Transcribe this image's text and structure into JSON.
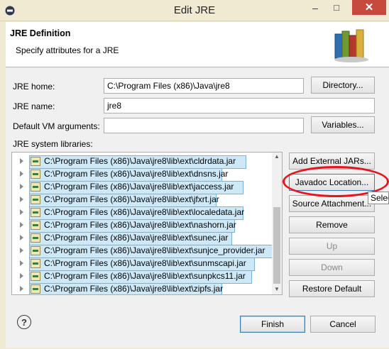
{
  "window": {
    "title": "Edit JRE",
    "minimize_glyph": "–",
    "maximize_glyph": "□",
    "close_glyph": "✕"
  },
  "header": {
    "title": "JRE Definition",
    "subtitle": "Specify attributes for a JRE"
  },
  "form": {
    "jre_home_label": "JRE home:",
    "jre_home_value": "C:\\Program Files (x86)\\Java\\jre8",
    "directory_button": "Directory...",
    "jre_name_label": "JRE name:",
    "jre_name_value": "jre8",
    "vm_args_label": "Default VM arguments:",
    "vm_args_value": "",
    "variables_button": "Variables...",
    "libraries_label": "JRE system libraries:"
  },
  "libraries": [
    "C:\\Program Files (x86)\\Java\\jre8\\lib\\ext\\cldrdata.jar",
    "C:\\Program Files (x86)\\Java\\jre8\\lib\\ext\\dnsns.jar",
    "C:\\Program Files (x86)\\Java\\jre8\\lib\\ext\\jaccess.jar",
    "C:\\Program Files (x86)\\Java\\jre8\\lib\\ext\\jfxrt.jar",
    "C:\\Program Files (x86)\\Java\\jre8\\lib\\ext\\localedata.jar",
    "C:\\Program Files (x86)\\Java\\jre8\\lib\\ext\\nashorn.jar",
    "C:\\Program Files (x86)\\Java\\jre8\\lib\\ext\\sunec.jar",
    "C:\\Program Files (x86)\\Java\\jre8\\lib\\ext\\sunjce_provider.jar",
    "C:\\Program Files (x86)\\Java\\jre8\\lib\\ext\\sunmscapi.jar",
    "C:\\Program Files (x86)\\Java\\jre8\\lib\\ext\\sunpkcs11.jar",
    "C:\\Program Files (x86)\\Java\\jre8\\lib\\ext\\zipfs.jar"
  ],
  "side_buttons": {
    "add_external_jars": "Add External JARs...",
    "javadoc_location": "Javadoc Location...",
    "source_attachment": "Source Attachment...",
    "remove": "Remove",
    "up": "Up",
    "down": "Down",
    "restore_default": "Restore Default"
  },
  "tooltip_text": "Select",
  "footer": {
    "help_glyph": "?",
    "finish": "Finish",
    "cancel": "Cancel"
  },
  "colors": {
    "close_button": "#c74a3f",
    "selection": "#cde8f7",
    "annotation_circle": "#e8141c"
  }
}
